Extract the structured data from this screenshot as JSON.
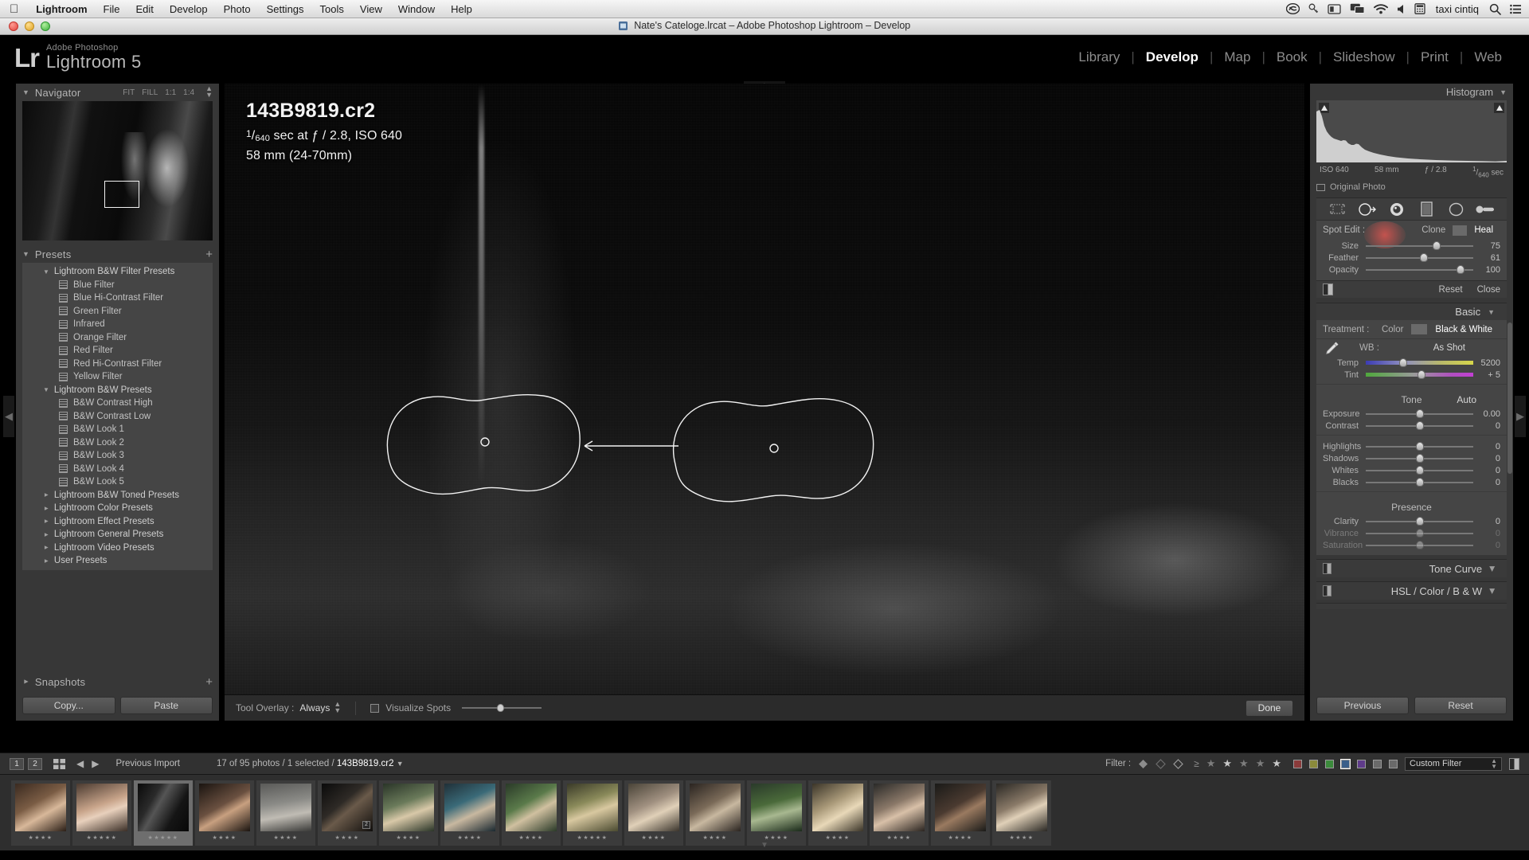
{
  "macbar": {
    "app_name": "Lightroom",
    "menus": [
      "File",
      "Edit",
      "Develop",
      "Photo",
      "Settings",
      "Tools",
      "View",
      "Window",
      "Help"
    ],
    "status_icons": [
      "creative-cloud-icon",
      "dropbox-icon",
      "display-icon",
      "screen-sharing-icon",
      "wifi-icon",
      "volume-icon",
      "calculator-icon"
    ],
    "user_label": "taxi cintiq",
    "right_icons": [
      "search-icon",
      "notification-center-icon"
    ]
  },
  "window": {
    "title": "Nate's Cateloge.lrcat – Adobe Photoshop Lightroom – Develop"
  },
  "header": {
    "brand_sub": "Adobe Photoshop",
    "brand_name": "Lightroom 5",
    "brand_mark": "Lr",
    "modules": [
      {
        "label": "Library",
        "active": false
      },
      {
        "label": "Develop",
        "active": true
      },
      {
        "label": "Map",
        "active": false
      },
      {
        "label": "Book",
        "active": false
      },
      {
        "label": "Slideshow",
        "active": false
      },
      {
        "label": "Print",
        "active": false
      },
      {
        "label": "Web",
        "active": false
      }
    ]
  },
  "navigator": {
    "title": "Navigator",
    "modes": [
      "FIT",
      "FILL",
      "1:1"
    ],
    "zoom_stepper": "1:4"
  },
  "presets": {
    "title": "Presets",
    "add_label": "+",
    "groups": [
      {
        "label": "Lightroom B&W Filter Presets",
        "expanded": true,
        "items": [
          "Blue Filter",
          "Blue Hi-Contrast Filter",
          "Green Filter",
          "Infrared",
          "Orange Filter",
          "Red Filter",
          "Red Hi-Contrast Filter",
          "Yellow Filter"
        ]
      },
      {
        "label": "Lightroom B&W Presets",
        "expanded": true,
        "items": [
          "B&W Contrast High",
          "B&W Contrast Low",
          "B&W Look 1",
          "B&W Look 2",
          "B&W Look 3",
          "B&W Look 4",
          "B&W Look 5"
        ]
      },
      {
        "label": "Lightroom B&W Toned Presets",
        "expanded": false,
        "items": []
      },
      {
        "label": "Lightroom Color Presets",
        "expanded": false,
        "items": []
      },
      {
        "label": "Lightroom Effect Presets",
        "expanded": false,
        "items": []
      },
      {
        "label": "Lightroom General Presets",
        "expanded": false,
        "items": []
      },
      {
        "label": "Lightroom Video Presets",
        "expanded": false,
        "items": []
      },
      {
        "label": "User Presets",
        "expanded": false,
        "items": []
      }
    ]
  },
  "snapshots": {
    "title": "Snapshots",
    "add_label": "+"
  },
  "left_buttons": {
    "copy": "Copy...",
    "paste": "Paste"
  },
  "photo": {
    "filename": "143B9819.cr2",
    "shutter_sup": "1",
    "shutter_sub": "640",
    "exposure_line": " sec at ƒ / 2.8, ISO 640",
    "lens_line": "58 mm (24-70mm)"
  },
  "photo_toolbar": {
    "tool_overlay_label": "Tool Overlay :",
    "tool_overlay_value": "Always",
    "visualize_spots": "Visualize Spots",
    "visualize_checked": false,
    "done": "Done"
  },
  "histogram": {
    "title": "Histogram",
    "iso": "ISO 640",
    "focal": "58 mm",
    "aperture": "ƒ / 2.8",
    "shutter_sup": "1",
    "shutter_sub": "640",
    "shutter_unit": "sec",
    "original_photo": "Original Photo"
  },
  "tools": {
    "icons": [
      "crop-overlay-icon",
      "spot-removal-icon",
      "red-eye-icon",
      "graduated-filter-icon",
      "radial-filter-icon",
      "adjustment-brush-icon"
    ],
    "active_index": 1
  },
  "spot_edit": {
    "label": "Spot Edit :",
    "modes": [
      {
        "label": "Clone",
        "active": false
      },
      {
        "label": "Heal",
        "active": true
      }
    ],
    "sliders": [
      {
        "label": "Size",
        "value": "75",
        "pos": 66
      },
      {
        "label": "Feather",
        "value": "61",
        "pos": 54
      },
      {
        "label": "Opacity",
        "value": "100",
        "pos": 88
      }
    ],
    "reset": "Reset",
    "close": "Close"
  },
  "basic": {
    "title": "Basic",
    "treatment_label": "Treatment :",
    "treatments": [
      {
        "label": "Color",
        "active": false
      },
      {
        "label": "Black & White",
        "active": true
      }
    ],
    "wb_label": "WB :",
    "wb_value": "As Shot",
    "wb_sliders": [
      {
        "label": "Temp",
        "value": "5200",
        "pos": 35,
        "type": "temp"
      },
      {
        "label": "Tint",
        "value": "+ 5",
        "pos": 52,
        "type": "tint"
      }
    ],
    "tone_label": "Tone",
    "auto_label": "Auto",
    "tone_sliders": [
      {
        "label": "Exposure",
        "value": "0.00",
        "pos": 50,
        "dim": false
      },
      {
        "label": "Contrast",
        "value": "0",
        "pos": 50,
        "dim": false
      }
    ],
    "tone_sliders2": [
      {
        "label": "Highlights",
        "value": "0",
        "pos": 50,
        "dim": false
      },
      {
        "label": "Shadows",
        "value": "0",
        "pos": 50,
        "dim": false
      },
      {
        "label": "Whites",
        "value": "0",
        "pos": 50,
        "dim": false
      },
      {
        "label": "Blacks",
        "value": "0",
        "pos": 50,
        "dim": false
      }
    ],
    "presence_label": "Presence",
    "presence_sliders": [
      {
        "label": "Clarity",
        "value": "0",
        "pos": 50,
        "dim": false
      },
      {
        "label": "Vibrance",
        "value": "0",
        "pos": 50,
        "dim": true
      },
      {
        "label": "Saturation",
        "value": "0",
        "pos": 50,
        "dim": true
      }
    ]
  },
  "collapsed_panels": [
    {
      "title": "Tone Curve"
    },
    {
      "title": "HSL / Color / B & W"
    }
  ],
  "right_buttons": {
    "previous": "Previous",
    "reset": "Reset"
  },
  "filmstrip_bar": {
    "page1": "1",
    "page2": "2",
    "previous_import": "Previous Import",
    "count_prefix": "17 of 95 photos / 1 selected / ",
    "count_file": "143B9819.cr2",
    "filter_label": "Filter :",
    "custom_filter": "Custom Filter",
    "star_count": 5,
    "color_swatches": [
      "#8a3b3b",
      "#8a8a3b",
      "#3b8a3b",
      "#3b5f8a",
      "#5f3b8a",
      "#6a6a6a",
      "#6a6a6a"
    ],
    "selected_swatch_index": 3
  },
  "filmstrip": {
    "thumbs": [
      {
        "stars": "★★★★",
        "selected": false,
        "badge": "",
        "tone": "warm-portrait"
      },
      {
        "stars": "★★★★★",
        "selected": false,
        "badge": "",
        "tone": "bright-face"
      },
      {
        "stars": "★★★★★",
        "selected": true,
        "badge": "",
        "tone": "dark-bw"
      },
      {
        "stars": "★★★★",
        "selected": false,
        "badge": "",
        "tone": "dark-portrait"
      },
      {
        "stars": "★★★★",
        "selected": false,
        "badge": "",
        "tone": "gray-scene"
      },
      {
        "stars": "★★★★",
        "selected": false,
        "badge": "2",
        "tone": "dark-figure"
      },
      {
        "stars": "★★★★",
        "selected": false,
        "badge": "",
        "tone": "outdoor-portrait"
      },
      {
        "stars": "★★★★",
        "selected": false,
        "badge": "",
        "tone": "teal-portrait"
      },
      {
        "stars": "★★★★",
        "selected": false,
        "badge": "",
        "tone": "green-portrait"
      },
      {
        "stars": "★★★★★",
        "selected": false,
        "badge": "",
        "tone": "field-portrait"
      },
      {
        "stars": "★★★★",
        "selected": false,
        "badge": "",
        "tone": "light-portrait"
      },
      {
        "stars": "★★★★",
        "selected": false,
        "badge": "",
        "tone": "couple"
      },
      {
        "stars": "★★★★",
        "selected": false,
        "badge": "",
        "tone": "forest"
      },
      {
        "stars": "★★★★",
        "selected": false,
        "badge": "",
        "tone": "blonde"
      },
      {
        "stars": "★★★★",
        "selected": false,
        "badge": "",
        "tone": "man-portrait"
      },
      {
        "stars": "★★★★",
        "selected": false,
        "badge": "",
        "tone": "dark-couple"
      },
      {
        "stars": "★★★★",
        "selected": false,
        "badge": "",
        "tone": "smiling"
      }
    ]
  },
  "colors": {
    "panel_bg": "#373737",
    "panel_inner": "#454545",
    "accent_red": "#e05650",
    "text_primary": "#d2d2d2",
    "text_secondary": "#a6a6a6"
  }
}
